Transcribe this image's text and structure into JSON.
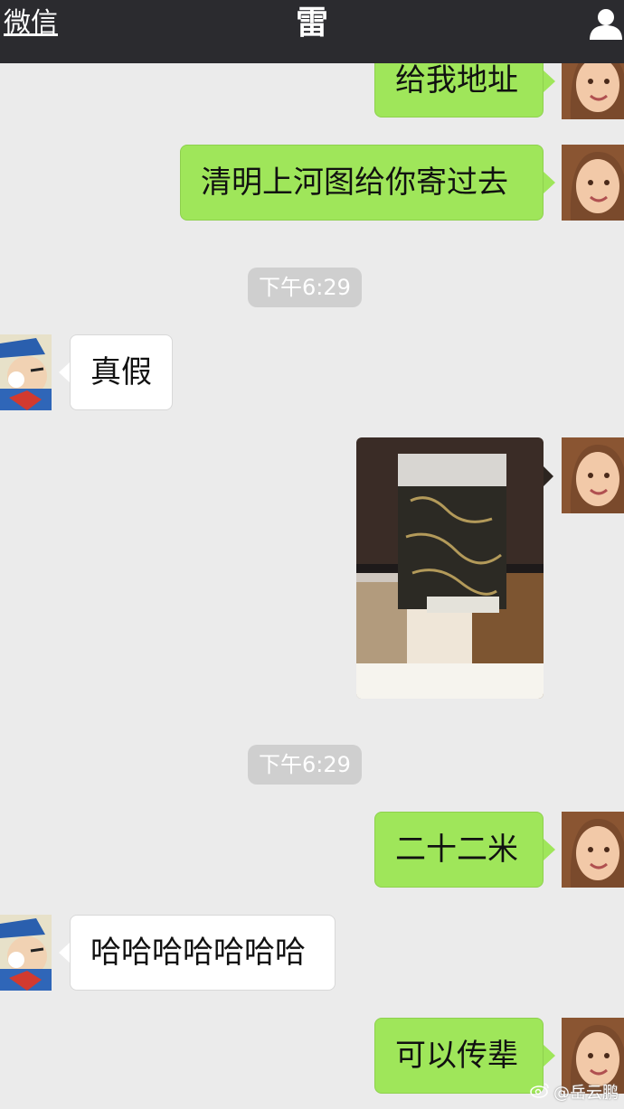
{
  "nav": {
    "back_label": "微信",
    "title": "雷",
    "profile_icon": "person-icon"
  },
  "messages": [
    {
      "side": "right",
      "type": "text",
      "text": "给我地址"
    },
    {
      "side": "right",
      "type": "text",
      "text": "清明上河图给你寄过去"
    },
    {
      "type": "time",
      "text": "下午6:29"
    },
    {
      "side": "left",
      "type": "text",
      "text": "真假"
    },
    {
      "side": "right",
      "type": "image",
      "image_desc": "boxed-scroll-photo"
    },
    {
      "type": "time",
      "text": "下午6:29"
    },
    {
      "side": "right",
      "type": "text",
      "text": "二十二米"
    },
    {
      "side": "left",
      "type": "text",
      "text": "哈哈哈哈哈哈哈"
    },
    {
      "side": "right",
      "type": "text",
      "text": "可以传辈"
    }
  ],
  "watermark": {
    "text": "@岳云鹏",
    "icon": "weibo-icon"
  },
  "colors": {
    "navbar": "#2b2b2f",
    "background": "#ebebeb",
    "sent_bubble": "#9fe65a",
    "received_bubble": "#ffffff",
    "timestamp_bg": "#cfcfcf"
  }
}
